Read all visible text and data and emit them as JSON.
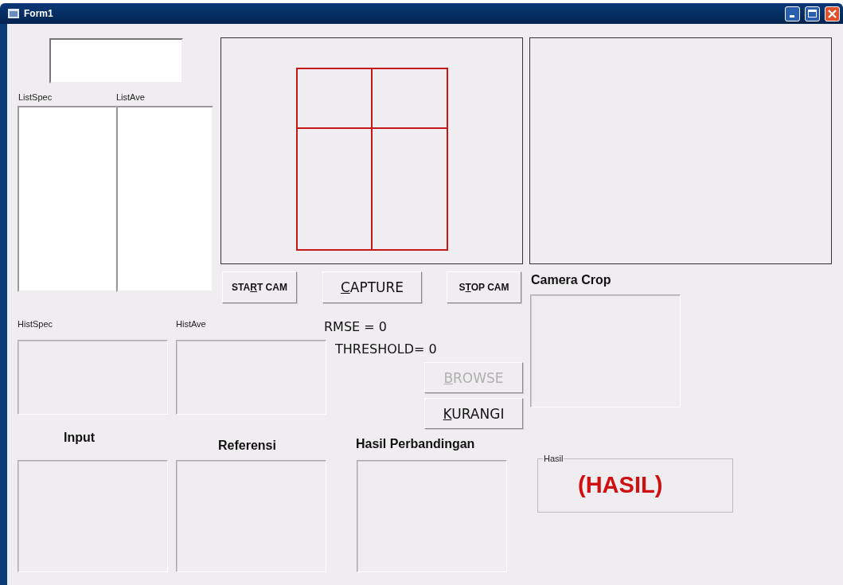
{
  "window": {
    "title": "Form1"
  },
  "list_labels": [
    "ListSpec",
    "ListAve"
  ],
  "camera_buttons": [
    {
      "lead": "STA",
      "key": "R",
      "rest": "T CAM",
      "disabled": false,
      "kind": "small"
    },
    {
      "key": "C",
      "rest": "APTURE",
      "disabled": false,
      "kind": "large"
    },
    {
      "lead": "S",
      "key": "T",
      "rest": "OP CAM",
      "disabled": false,
      "kind": "small"
    }
  ],
  "camera_crop_label": "Camera Crop",
  "hist_labels": [
    "HistSpec",
    "HistAve"
  ],
  "rmse": "RMSE =  0",
  "threshold": "THRESHOLD= 0",
  "action_buttons": [
    {
      "key": "B",
      "rest": "ROWSE",
      "disabled": true,
      "kind": "large"
    },
    {
      "key": "K",
      "rest": "URANGI",
      "disabled": false,
      "kind": "large"
    }
  ],
  "image_captions": [
    "Input",
    "Referensi",
    "Hasil Perbandingan"
  ],
  "result_frame": {
    "caption": "Hasil",
    "value": "(HASIL)"
  }
}
